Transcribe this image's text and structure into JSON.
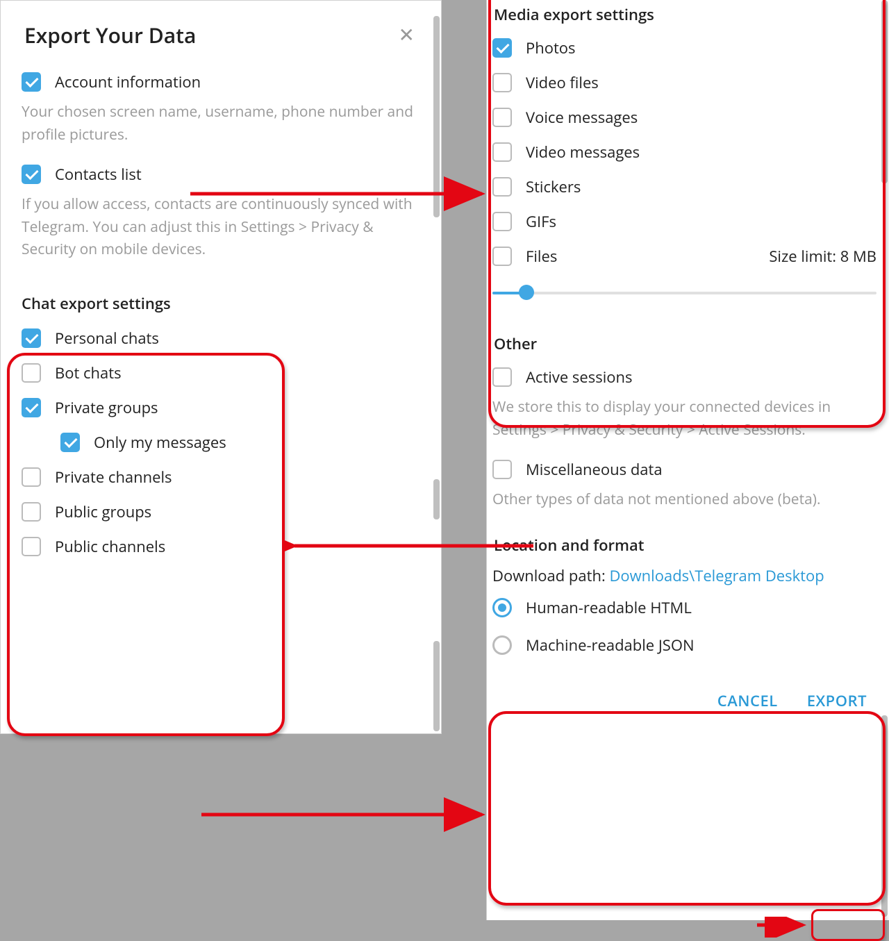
{
  "header": {
    "title": "Export Your Data"
  },
  "account": {
    "label": "Account information",
    "desc": "Your chosen screen name, username, phone number and profile pictures."
  },
  "contacts": {
    "label": "Contacts list",
    "desc": "If you allow access, contacts are continuously synced with Telegram. You can adjust this in Settings > Privacy & Security on mobile devices."
  },
  "chatSettings": {
    "title": "Chat export settings",
    "items": {
      "personal": "Personal chats",
      "bot": "Bot chats",
      "privateGroups": "Private groups",
      "onlyMy": "Only my messages",
      "privateChannels": "Private channels",
      "publicGroups": "Public groups",
      "publicChannels": "Public channels"
    }
  },
  "media": {
    "title": "Media export settings",
    "items": {
      "photos": "Photos",
      "videoFiles": "Video files",
      "voice": "Voice messages",
      "videoMsg": "Video messages",
      "stickers": "Stickers",
      "gifs": "GIFs",
      "files": "Files"
    },
    "sizeLimit": "Size limit: 8 MB"
  },
  "other": {
    "title": "Other",
    "active": "Active sessions",
    "activeDesc": "We store this to display your connected devices in Settings > Privacy & Security > Active Sessions.",
    "misc": "Miscellaneous data",
    "miscDesc": "Other types of data not mentioned above (beta)."
  },
  "location": {
    "title": "Location and format",
    "pathLabel": "Download path: ",
    "path": "Downloads\\Telegram Desktop",
    "html": "Human-readable HTML",
    "json": "Machine-readable JSON"
  },
  "buttons": {
    "cancel": "CANCEL",
    "export": "EXPORT"
  }
}
